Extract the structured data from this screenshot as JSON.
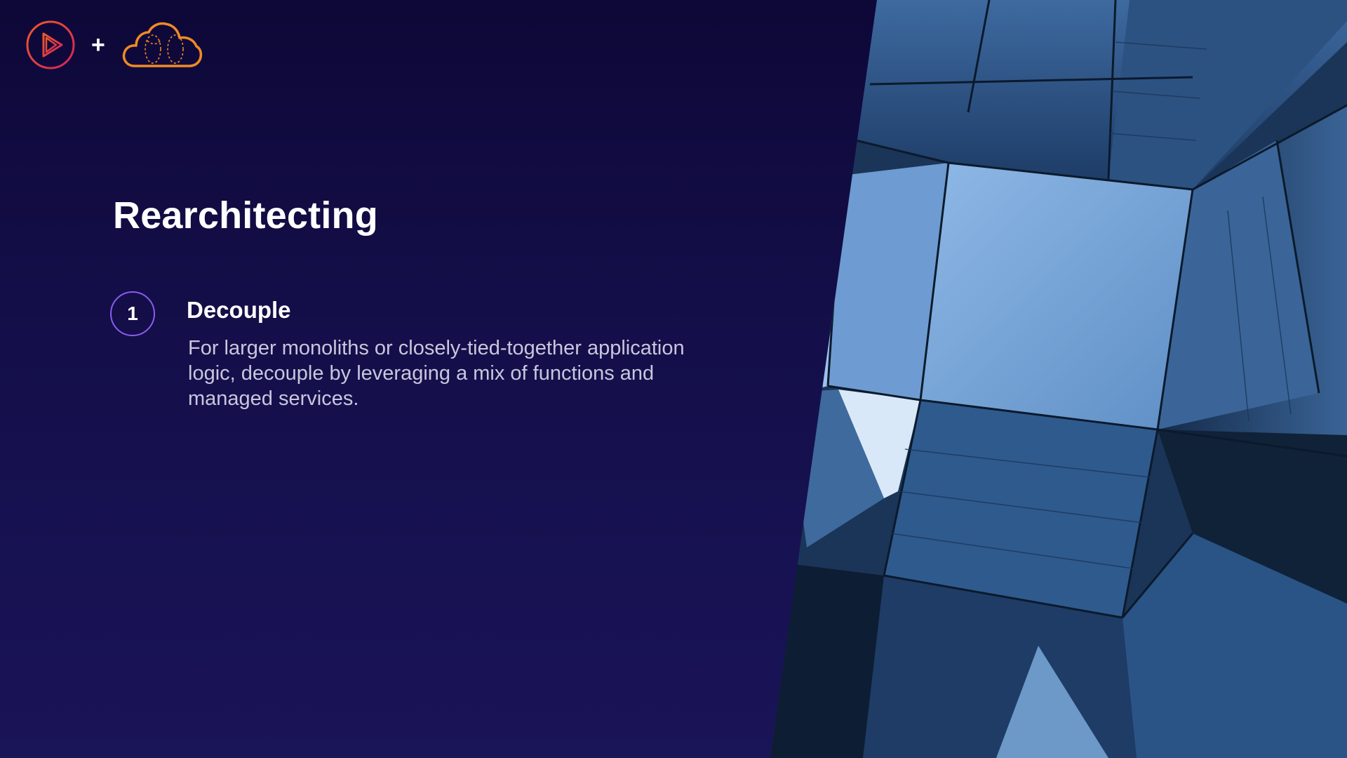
{
  "brand": {
    "play_logo": "play-logo",
    "plus_symbol": "+",
    "cloud_logo": "cloud-logo"
  },
  "slide": {
    "title": "Rearchitecting",
    "steps": [
      {
        "number": "1",
        "title": "Decouple",
        "description": "For larger monoliths or closely-tied-together application logic, decouple by leveraging a mix of functions and managed services."
      }
    ]
  },
  "colors": {
    "background_top": "#0e0838",
    "background_bottom": "#1a1458",
    "play_logo_gradient": [
      "#f05a28",
      "#d1235b"
    ],
    "cloud_logo": "#f08a24",
    "step_ring": "#8a5cf0",
    "glass_highlight": "#6f9bd0",
    "glass_dark": "#0c1d35"
  }
}
